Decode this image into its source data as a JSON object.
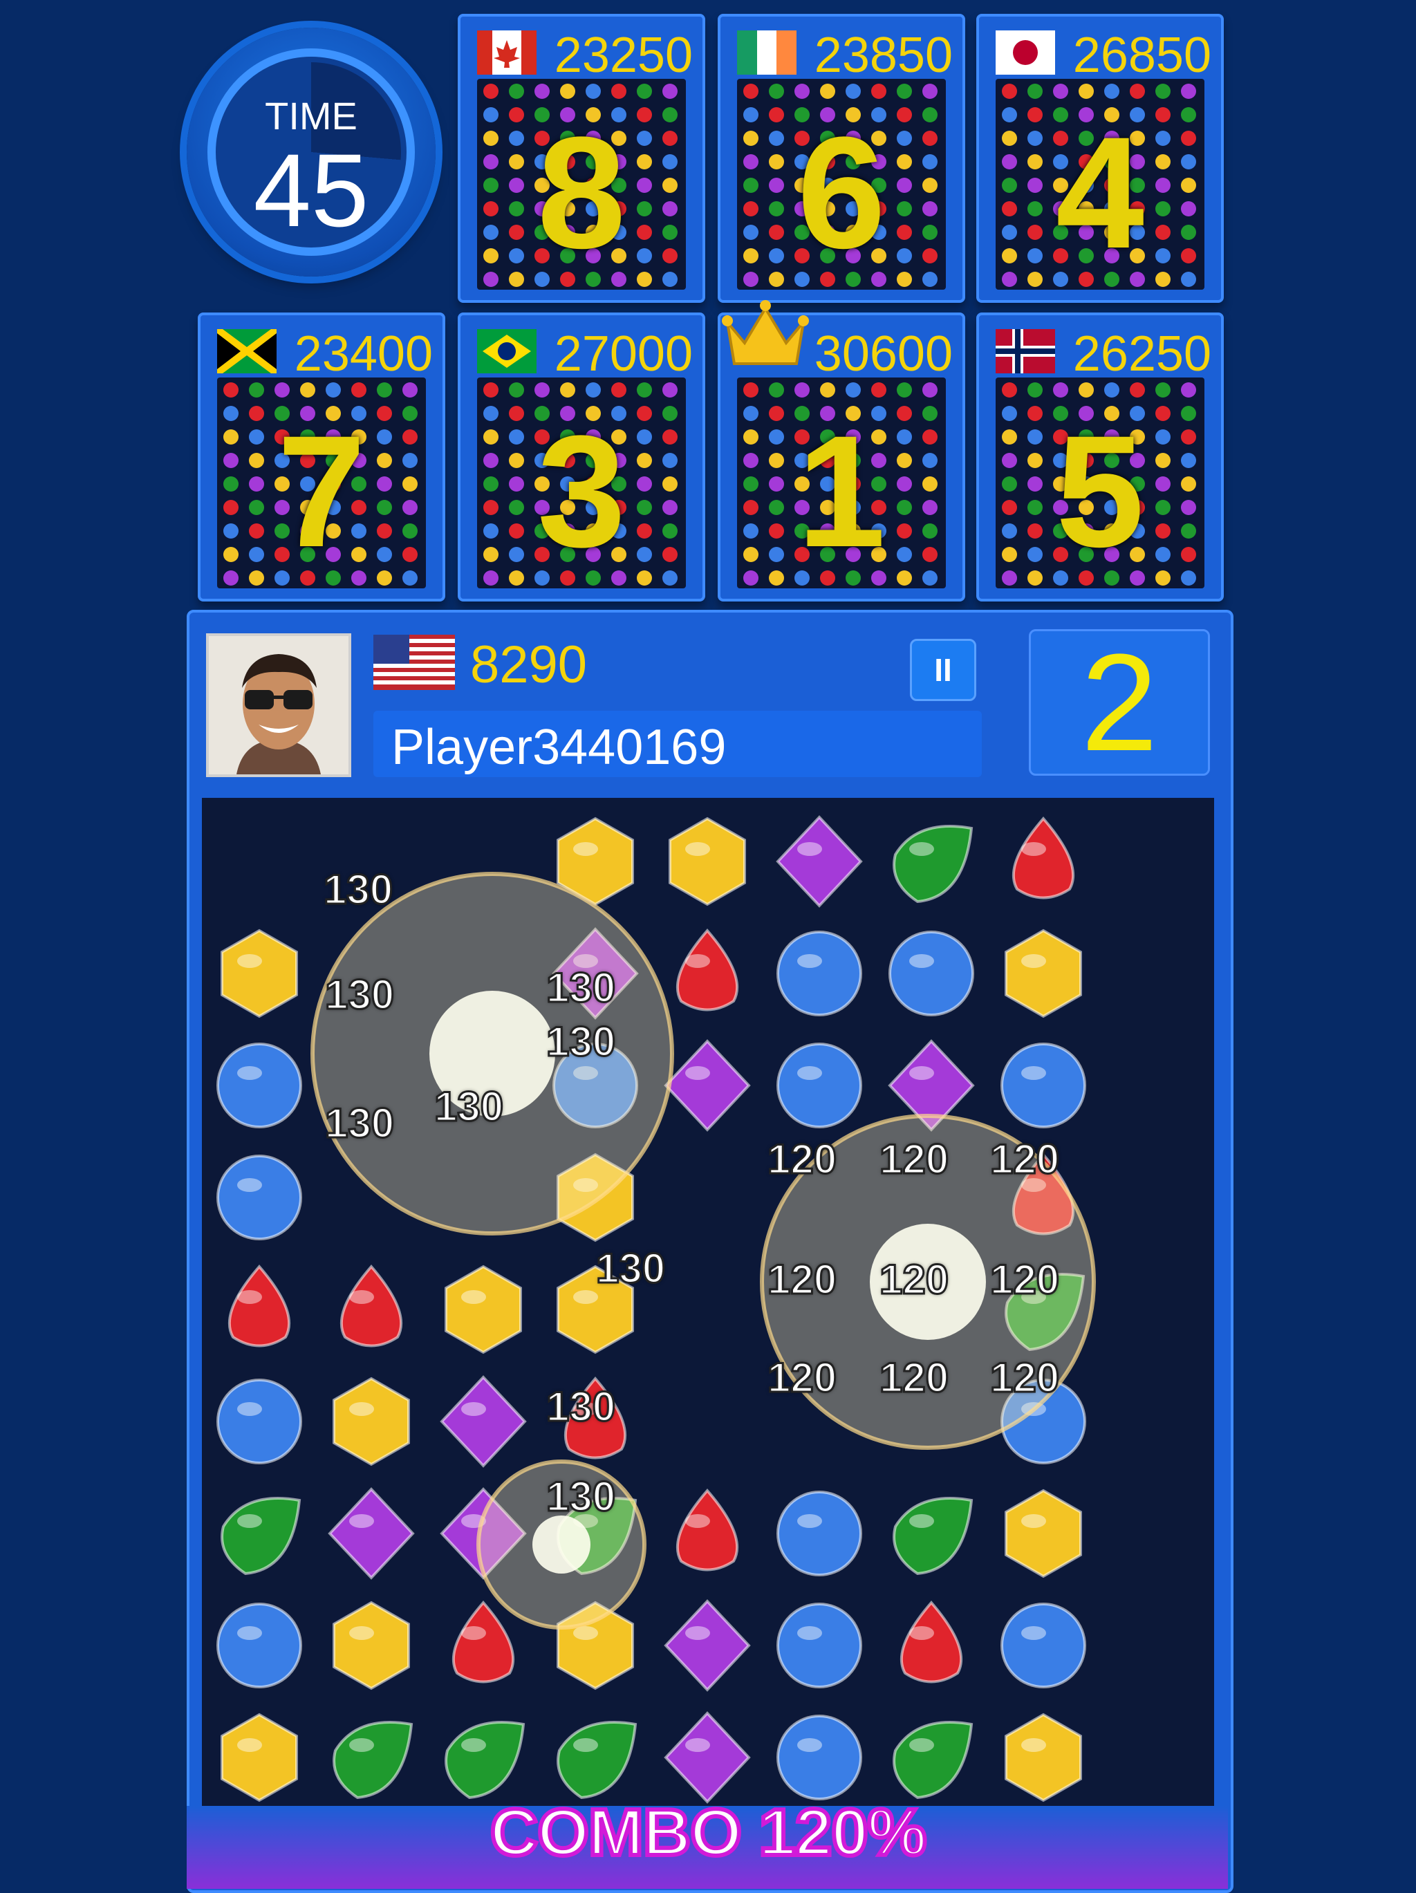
{
  "timer": {
    "label": "TIME",
    "value": "45"
  },
  "opponents": [
    {
      "flag": "canada",
      "score": "23250",
      "rank": "8",
      "crown": false
    },
    {
      "flag": "ireland",
      "score": "23850",
      "rank": "6",
      "crown": false
    },
    {
      "flag": "japan",
      "score": "26850",
      "rank": "4",
      "crown": false
    },
    {
      "flag": "jamaica",
      "score": "23400",
      "rank": "7",
      "crown": false
    },
    {
      "flag": "brazil",
      "score": "27000",
      "rank": "3",
      "crown": false
    },
    {
      "flag": "",
      "score": "30600",
      "rank": "1",
      "crown": true
    },
    {
      "flag": "norway",
      "score": "26250",
      "rank": "5",
      "crown": false
    }
  ],
  "player": {
    "flag": "usa",
    "score": "8290",
    "name": "Player3440169",
    "rank": "2",
    "pause_icon": "II"
  },
  "board": {
    "rows": [
      [
        "",
        "",
        "",
        "yellow",
        "yellow",
        "purple",
        "green",
        "red"
      ],
      [
        "yellow",
        "",
        "",
        "purple",
        "red",
        "blue",
        "blue",
        "yellow"
      ],
      [
        "blue",
        "",
        "",
        "blue",
        "purple",
        "blue",
        "purple",
        "blue"
      ],
      [
        "blue",
        "",
        "",
        "yellow",
        "",
        "",
        "",
        "red"
      ],
      [
        "red",
        "red",
        "yellow",
        "yellow",
        "",
        "",
        "",
        "green"
      ],
      [
        "blue",
        "yellow",
        "purple",
        "red",
        "",
        "",
        "",
        "blue"
      ],
      [
        "green",
        "purple",
        "purple",
        "green",
        "red",
        "blue",
        "green",
        "yellow"
      ],
      [
        "blue",
        "yellow",
        "red",
        "yellow",
        "purple",
        "blue",
        "red",
        "blue"
      ],
      [
        "yellow",
        "green",
        "green",
        "green",
        "purple",
        "blue",
        "green",
        "yellow"
      ]
    ],
    "popups_130": [
      "130",
      "130",
      "130",
      "130",
      "130",
      "130",
      "130",
      "130",
      "130"
    ],
    "popups_120": [
      "120",
      "120",
      "120",
      "120",
      "120",
      "120",
      "120",
      "120",
      "120"
    ]
  },
  "combo": "COMBO 120%",
  "colors": {
    "red": "#e0242c",
    "yellow": "#f3c425",
    "green": "#1f9a2e",
    "blue": "#3a7ee6",
    "purple": "#a43ad8",
    "score": "#f5d40b"
  }
}
